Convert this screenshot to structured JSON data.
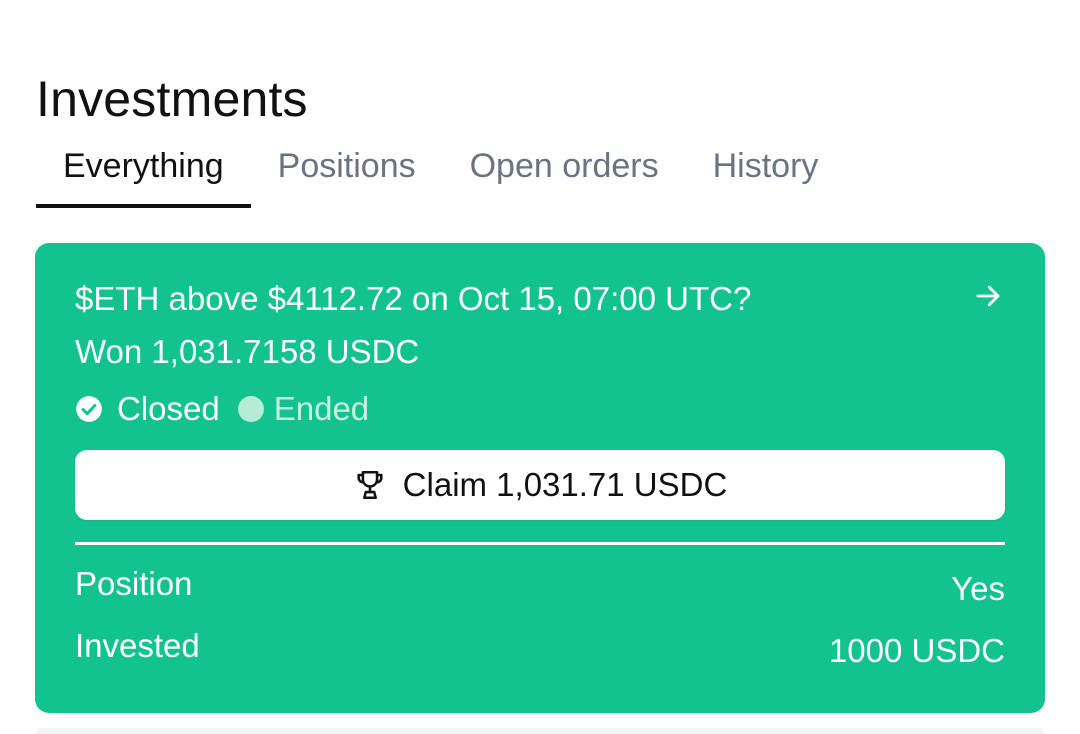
{
  "page": {
    "title": "Investments"
  },
  "tabs": [
    {
      "label": "Everything",
      "active": true
    },
    {
      "label": "Positions",
      "active": false
    },
    {
      "label": "Open orders",
      "active": false
    },
    {
      "label": "History",
      "active": false
    }
  ],
  "card": {
    "background_color": "#13c38f",
    "market_title": "$ETH above $4112.72 on Oct 15, 07:00 UTC?",
    "outcome_text": "Won 1,031.7158 USDC",
    "status": {
      "closed_label": "Closed",
      "ended_label": "Ended"
    },
    "claim_button_label": "Claim 1,031.71 USDC",
    "details": {
      "position_label": "Position",
      "position_value": "Yes",
      "invested_label": "Invested",
      "invested_value": "1000 USDC"
    },
    "icons": {
      "arrow": "arrow-right-icon",
      "check": "check-circle-icon",
      "trophy": "trophy-icon"
    }
  }
}
